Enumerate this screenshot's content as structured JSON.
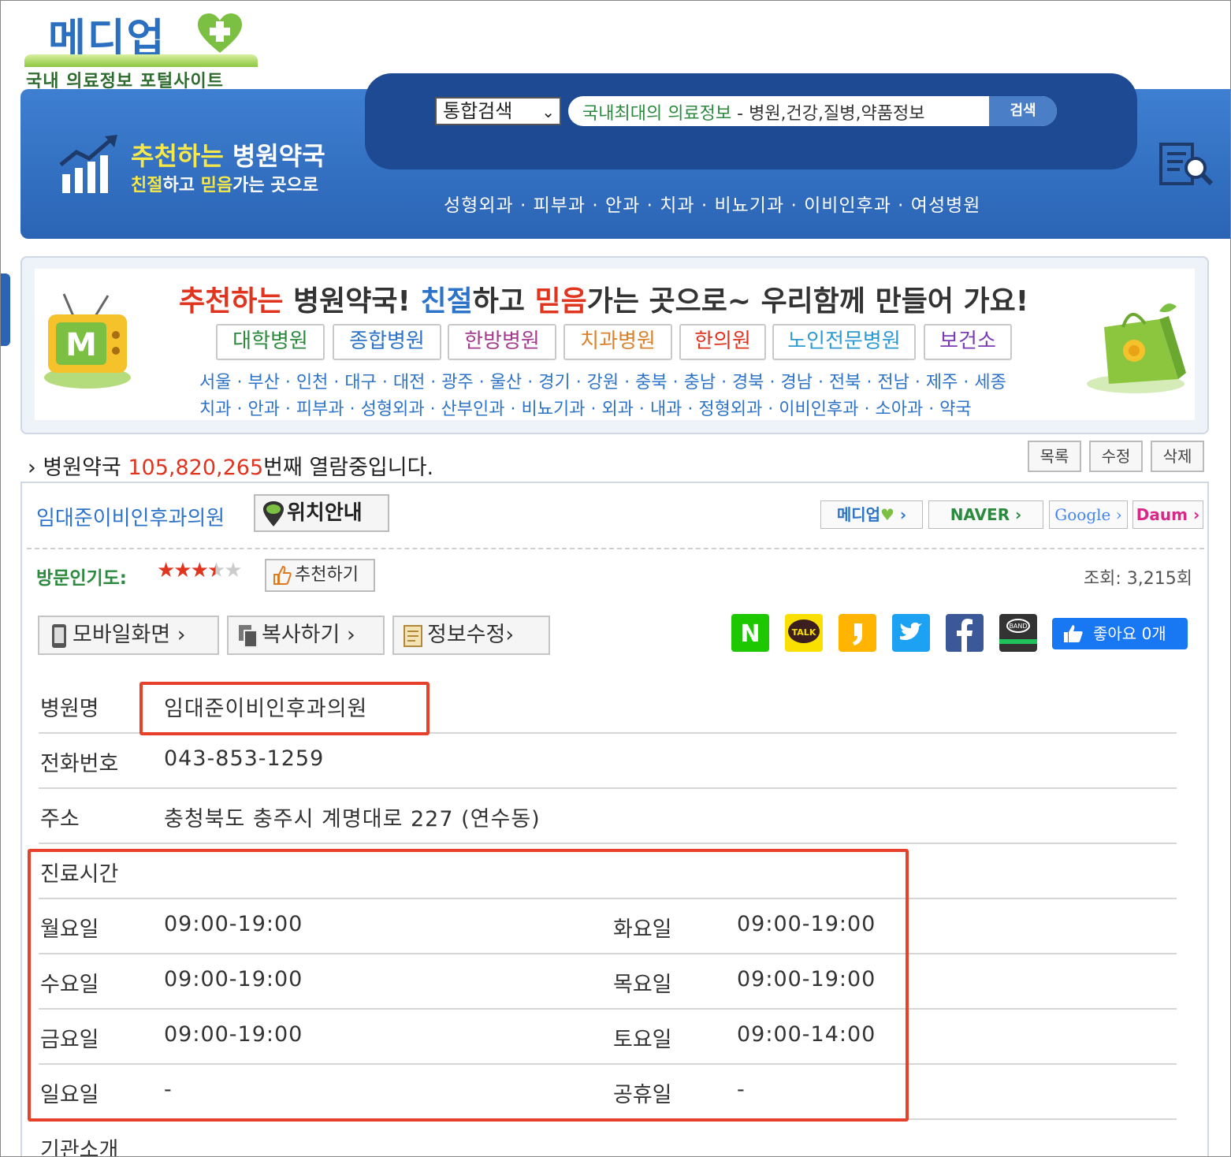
{
  "logo": {
    "name": "메디업",
    "tagline": "국내 의료정보 포털사이트"
  },
  "search": {
    "select_value": "통합검색",
    "placeholder_green": "국내최대의 의료정보",
    "placeholder_rest": " - 병원,건강,질병,약품정보",
    "button_label": "검색"
  },
  "banner": {
    "title_y": "추천하는",
    "title_w": " 병원약국",
    "sub_y1": "친절",
    "sub_w1": "하고 ",
    "sub_y2": "믿음",
    "sub_w2": "가는 곳으로"
  },
  "dept_nav": "성형외과 · 피부과 · 안과 · 치과 · 비뇨기과 · 이비인후과 · 여성병원",
  "category": {
    "headline_r1": "추천하는",
    "headline_1": " 병원약국! ",
    "headline_b": "친절",
    "headline_2": "하고 ",
    "headline_r2": "믿음",
    "headline_3": "가는 곳으로~ 우리함께 만들어 가요!",
    "buttons": [
      {
        "label": "대학병원",
        "color": "#2b8a3e"
      },
      {
        "label": "종합병원",
        "color": "#2d73c9"
      },
      {
        "label": "한방병원",
        "color": "#a63a8f"
      },
      {
        "label": "치과병원",
        "color": "#d9822b"
      },
      {
        "label": "한의원",
        "color": "#e0341f"
      },
      {
        "label": "노인전문병원",
        "color": "#2d9ad1"
      },
      {
        "label": "보건소",
        "color": "#7a3bb5"
      }
    ],
    "regions": "서울 · 부산 · 인천 · 대구 · 대전 · 광주 · 울산 · 경기 · 강원 · 충북 · 충남 · 경북 · 경남 · 전북 · 전남 · 제주 · 세종",
    "departments": "치과 · 안과 · 피부과 · 성형외과 · 산부인과 · 비뇨기과 · 외과 · 내과 · 정형외과 · 이비인후과 · 소아과 · 약국"
  },
  "view": {
    "prefix": "병원약국 ",
    "count": "105,820,265",
    "suffix": "번째 열람중입니다."
  },
  "actions": {
    "list": "목록",
    "edit": "수정",
    "delete": "삭제"
  },
  "hospital": {
    "title": "임대준이비인후과의원",
    "location_button": "위치안내",
    "ext_links": [
      "메디업",
      "NAVER",
      "Google",
      "Daum"
    ],
    "popularity_label": "방문인기도:",
    "rating": 3.5,
    "rating_max": 5,
    "recommend_button": "추천하기",
    "views": "조회: 3,215회"
  },
  "tools": {
    "mobile": "모바일화면",
    "copy": "복사하기",
    "edit_info": "정보수정"
  },
  "share": {
    "icons": [
      "naver-blog",
      "kakao-talk",
      "kakao-story",
      "twitter",
      "facebook",
      "band"
    ],
    "like_label": "좋아요",
    "like_count": "0개"
  },
  "details": {
    "name_label": "병원명",
    "name_value": "임대준이비인후과의원",
    "phone_label": "전화번호",
    "phone_value": "043-853-1259",
    "address_label": "주소",
    "address_value": "충청북도 충주시 계명대로 227 (연수동)",
    "hours_label": "진료시간",
    "hours": [
      {
        "day": "월요일",
        "time": "09:00-19:00"
      },
      {
        "day": "화요일",
        "time": "09:00-19:00"
      },
      {
        "day": "수요일",
        "time": "09:00-19:00"
      },
      {
        "day": "목요일",
        "time": "09:00-19:00"
      },
      {
        "day": "금요일",
        "time": "09:00-19:00"
      },
      {
        "day": "토요일",
        "time": "09:00-14:00"
      },
      {
        "day": "일요일",
        "time": "-"
      },
      {
        "day": "공휴일",
        "time": "-"
      }
    ],
    "intro_label": "기관소개"
  },
  "colors": {
    "header_blue": "#2b64b5",
    "highlight_red": "#e8412b",
    "link_blue": "#2d73c9",
    "green": "#2b8a3e"
  }
}
